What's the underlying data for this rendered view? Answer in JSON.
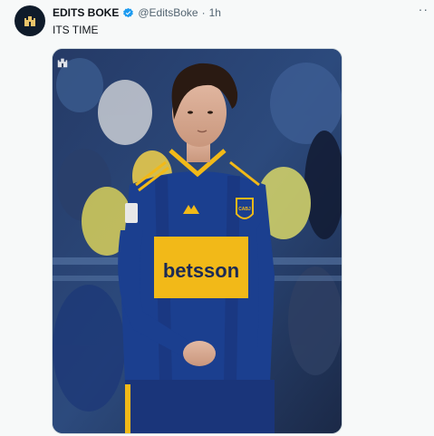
{
  "tweet": {
    "author": {
      "display_name": "EDITS BOKE",
      "handle": "@EditsBoke",
      "verified": true,
      "avatar_icon": "castle-logo-icon"
    },
    "separator": "·",
    "time": "1h",
    "text": "ITS TIME",
    "more_icon": "more-options-icon",
    "media": {
      "jersey_sponsor": "betsson",
      "badge_text": "CABJ",
      "watermark_icon": "castle-logo-icon"
    }
  },
  "colors": {
    "verified": "#1d9bf0",
    "jersey_blue": "#1b3f8f",
    "jersey_gold": "#f2b918",
    "text_secondary": "#536471"
  }
}
